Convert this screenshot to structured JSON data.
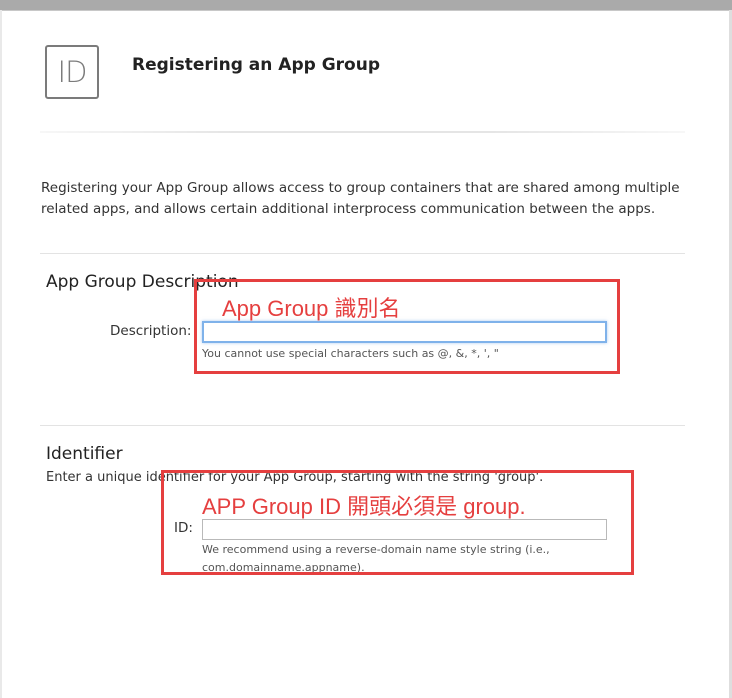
{
  "page": {
    "icon_text": "ID",
    "title": "Registering an App Group",
    "intro": "Registering your App Group allows access to group containers that are shared among multiple related apps, and allows certain additional interprocess communication between the apps."
  },
  "description_section": {
    "heading": "App Group Description",
    "label": "Description:",
    "value": "",
    "help": "You cannot use special characters such as @, &, *, ', \""
  },
  "identifier_section": {
    "heading": "Identifier",
    "intro": "Enter a unique identifier for your App Group, starting with the string 'group'.",
    "label": "ID:",
    "value": "",
    "help": "We recommend using a reverse-domain name style string (i.e., com.domainname.appname)."
  },
  "annotations": {
    "description_note": "App Group 識別名",
    "identifier_note": "APP Group ID 開頭必須是 group.",
    "color": "#e53f3f"
  }
}
